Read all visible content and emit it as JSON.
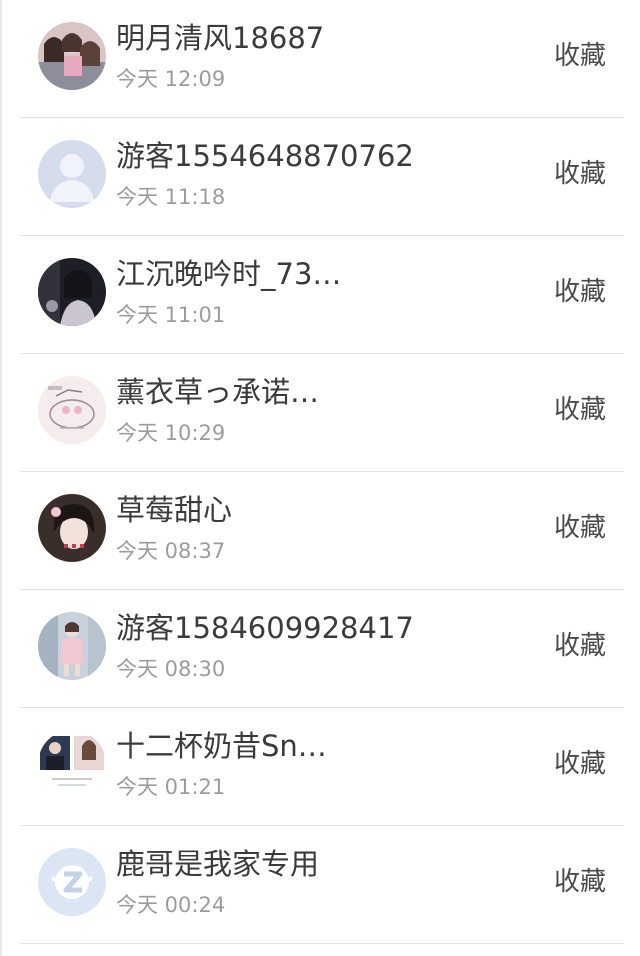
{
  "contacts": [
    {
      "name": "明月清风18687",
      "time": "今天 12:09",
      "action": "收藏",
      "avatar": "group-photo-avatar"
    },
    {
      "name": "游客1554648870762",
      "time": "今天 11:18",
      "action": "收藏",
      "avatar": "default-user-avatar"
    },
    {
      "name": "江沉晚吟时_73…",
      "time": "今天 11:01",
      "action": "收藏",
      "avatar": "dark-photo-avatar"
    },
    {
      "name": "薰衣草っ承诺…",
      "time": "今天 10:29",
      "action": "收藏",
      "avatar": "sketch-avatar"
    },
    {
      "name": "草莓甜心",
      "time": "今天 08:37",
      "action": "收藏",
      "avatar": "girl-photo-avatar"
    },
    {
      "name": "游客1584609928417",
      "time": "今天 08:30",
      "action": "收藏",
      "avatar": "pink-coat-avatar"
    },
    {
      "name": "十二杯奶昔Sn…",
      "time": "今天 01:21",
      "action": "收藏",
      "avatar": "couple-photo-avatar"
    },
    {
      "name": "鹿哥是我家专用",
      "time": "今天 00:24",
      "action": "收藏",
      "avatar": "qq-logo-avatar"
    }
  ]
}
